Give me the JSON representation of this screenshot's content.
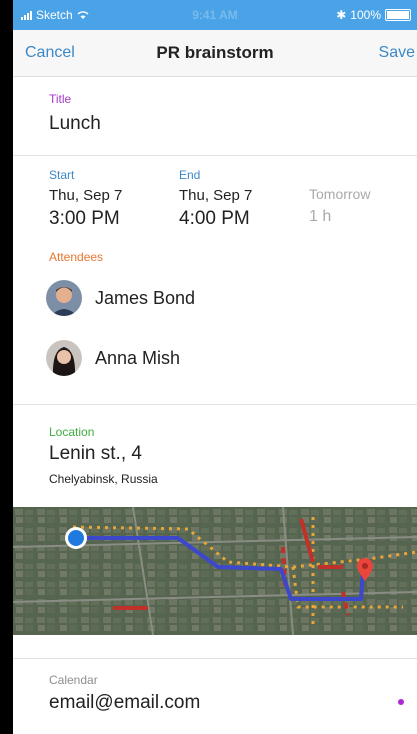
{
  "status_bar": {
    "carrier": "Sketch",
    "time": "9:41 AM",
    "battery": "100%"
  },
  "nav": {
    "cancel": "Cancel",
    "title": "PR brainstorm",
    "save": "Save"
  },
  "title_section": {
    "label": "Title",
    "value": "Lunch",
    "label_color": "#a23ac7"
  },
  "time_section": {
    "label_color": "#3b88c7",
    "start": {
      "label": "Start",
      "date": "Thu, Sep 7",
      "time": "3:00 PM"
    },
    "end": {
      "label": "End",
      "date": "Thu, Sep 7",
      "time": "4:00 PM"
    },
    "relative": {
      "day": "Tomorrow",
      "duration": "1 h"
    }
  },
  "attendees": {
    "label": "Attendees",
    "label_color": "#e8772e",
    "people": [
      {
        "name": "James Bond",
        "avatar_icon": "person-avatar-icon"
      },
      {
        "name": "Anna Mish",
        "avatar_icon": "person-avatar-icon"
      }
    ]
  },
  "location": {
    "label": "Location",
    "label_color": "#3fae3f",
    "address": "Lenin st., 4",
    "city": "Chelyabinsk, Russia"
  },
  "calendar": {
    "label": "Calendar",
    "value": "email@email.com",
    "dot_color": "#b028d6"
  }
}
